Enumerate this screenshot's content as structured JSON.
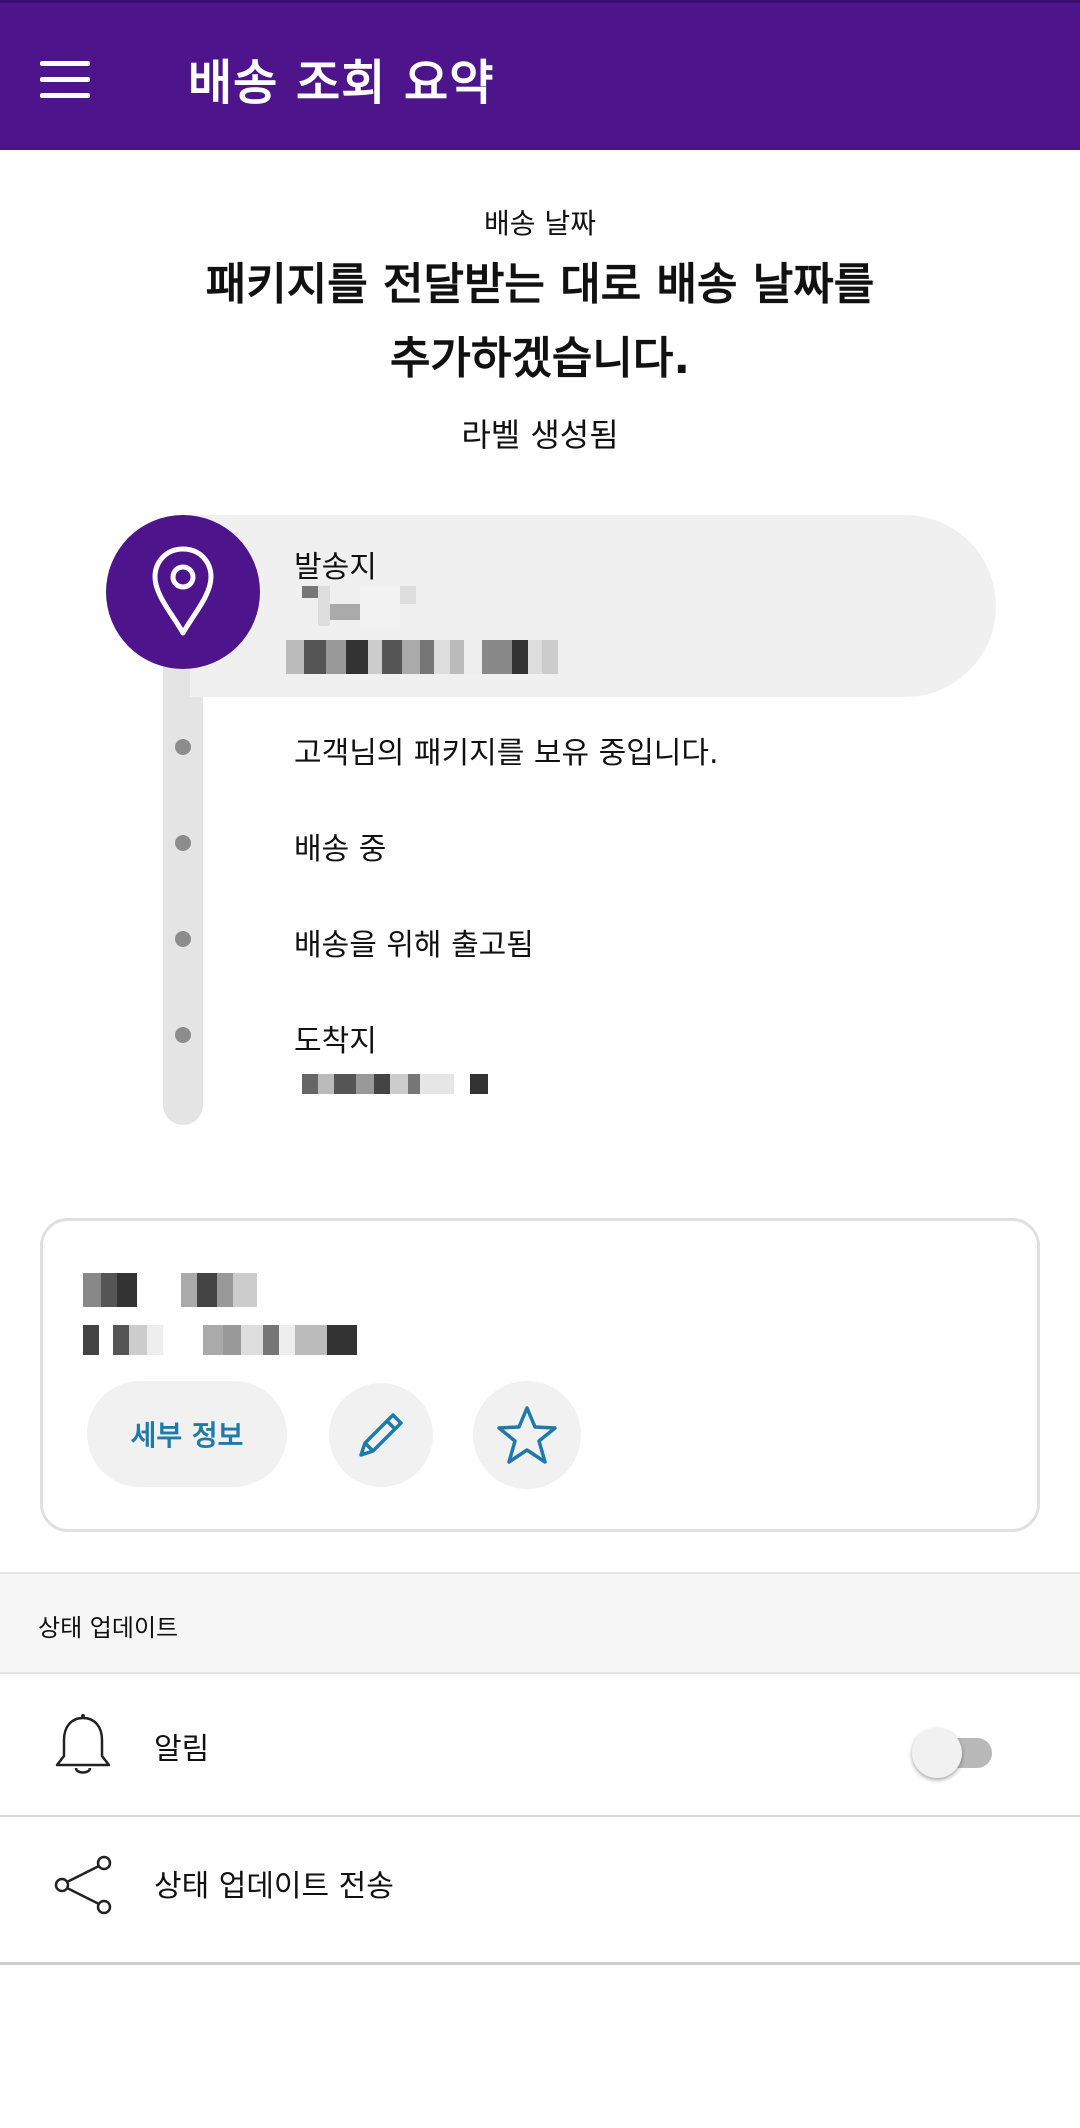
{
  "appbar": {
    "title": "배송 조회 요약"
  },
  "summary": {
    "delivery_label": "배송 날짜",
    "delivery_message_line1": "패키지를 전달받는 대로 배송 날짜를",
    "delivery_message_line2": "추가하겠습니다.",
    "status": "라벨 생성됨"
  },
  "timeline": {
    "origin_label": "발송지",
    "steps": [
      "고객님의 패키지를 보유 중입니다.",
      "배송 중",
      "배송을 위해 출고됨"
    ],
    "destination_label": "도착지"
  },
  "shipment_card": {
    "details_button": "세부 정보",
    "edit_icon": "pencil-icon",
    "favorite_icon": "star-icon"
  },
  "updates": {
    "section_title": "상태 업데이트",
    "notifications_label": "알림",
    "notifications_on": false,
    "send_updates_label": "상태 업데이트 전송"
  },
  "colors": {
    "brand_purple": "#4d148c",
    "link_blue": "#1f7aa8"
  }
}
